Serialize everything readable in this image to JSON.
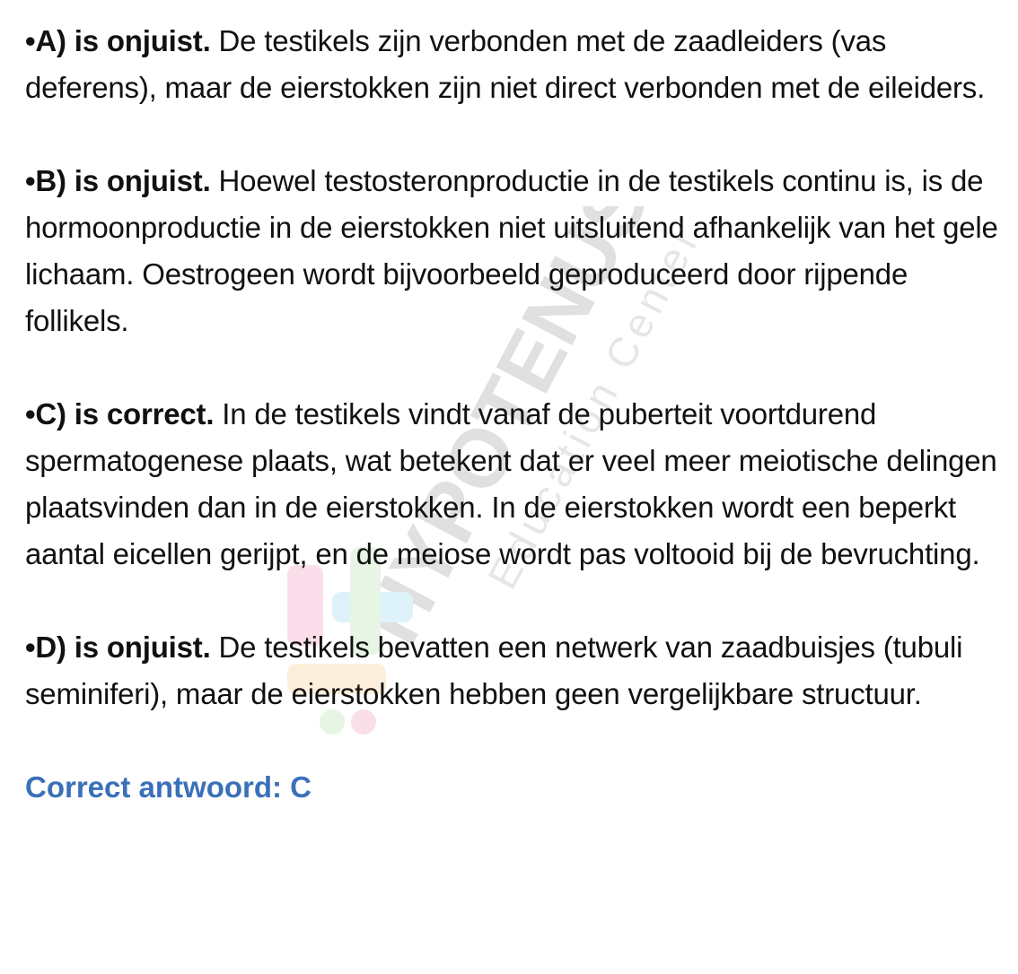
{
  "items": [
    {
      "lead": "•A) is onjuist.",
      "text": " De testikels zijn verbonden met de zaadleiders (vas deferens), maar de eierstokken zijn niet direct verbonden met de eileiders."
    },
    {
      "lead": "•B) is onjuist.",
      "text": " Hoewel testosteronproductie in de testikels continu is, is de hormoonproductie in de eierstokken niet uitsluitend afhankelijk van het gele lichaam. Oestrogeen wordt bijvoorbeeld geproduceerd door rijpende follikels."
    },
    {
      "lead": "•C) is correct.",
      "text": " In de testikels vindt vanaf de puberteit voortdurend spermatogenese plaats, wat betekent dat er veel meer meiotische delingen plaatsvinden dan in de eierstokken. In de eierstokken wordt een beperkt aantal eicellen gerijpt, en de meiose wordt pas voltooid bij de bevruchting."
    },
    {
      "lead": "•D) is onjuist.",
      "text": " De testikels bevatten een netwerk van zaadbuisjes (tubuli seminiferi), maar de eierstokken hebben geen vergelijkbare structuur."
    }
  ],
  "answer": "Correct antwoord: C",
  "watermark": {
    "brand": "HYPOTENUSE",
    "tagline": "Education Center",
    "accent_colors": [
      "#e84d8a",
      "#4dbde8",
      "#7bc96f",
      "#f2a93b"
    ]
  },
  "colors": {
    "text": "#111111",
    "answer": "#3a70b8"
  }
}
